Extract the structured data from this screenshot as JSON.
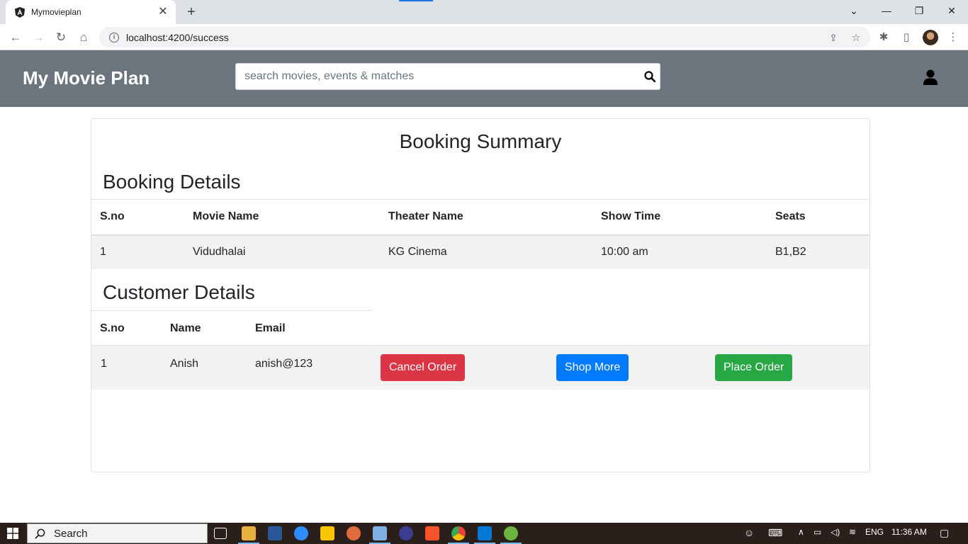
{
  "browser": {
    "tab_title": "Mymovieplan",
    "tab_close": "✕",
    "new_tab": "+",
    "url": "localhost:4200/success"
  },
  "navbar": {
    "brand": "My Movie Plan",
    "search_placeholder": "search movies, events & matches"
  },
  "summary": {
    "title": "Booking Summary",
    "booking_section": "Booking Details",
    "booking_headers": [
      "S.no",
      "Movie Name",
      "Theater Name",
      "Show Time",
      "Seats"
    ],
    "booking_rows": [
      [
        "1",
        "Vidudhalai",
        "KG Cinema",
        "10:00 am",
        "B1,B2"
      ]
    ],
    "customer_section": "Customer Details",
    "customer_headers": [
      "S.no",
      "Name",
      "Email"
    ],
    "customer_row": [
      "1",
      "Anish",
      "anish@123"
    ],
    "buttons": {
      "cancel": "Cancel Order",
      "shop": "Shop More",
      "place": "Place Order"
    }
  },
  "taskbar": {
    "search": "Search",
    "language": "ENG",
    "time": "11:36 AM"
  },
  "colors": {
    "navbar": "#6c757d",
    "danger": "#dc3545",
    "primary": "#007bff",
    "success": "#28a745"
  }
}
